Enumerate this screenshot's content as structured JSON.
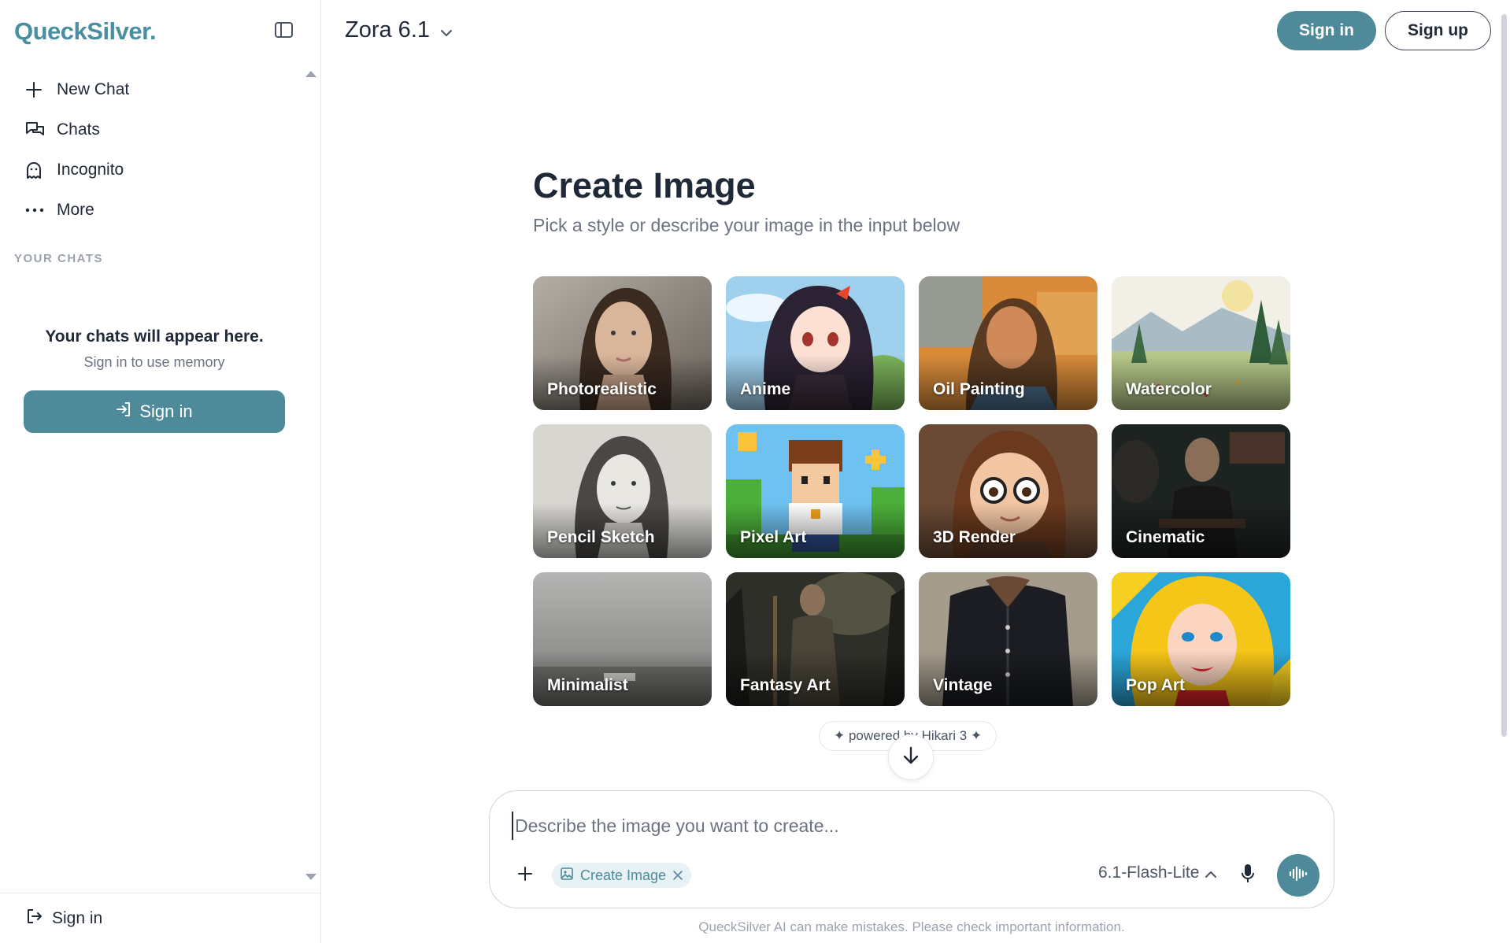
{
  "brand": {
    "name": "QueckSilver."
  },
  "sidebar": {
    "nav": [
      {
        "label": "New Chat",
        "icon": "plus-icon"
      },
      {
        "label": "Chats",
        "icon": "chats-icon"
      },
      {
        "label": "Incognito",
        "icon": "ghost-icon"
      },
      {
        "label": "More",
        "icon": "more-icon"
      }
    ],
    "section_label": "YOUR CHATS",
    "empty_title": "Your chats will appear here.",
    "empty_subtitle": "Sign in to use memory",
    "signin_label": "Sign in",
    "footer_signin_label": "Sign in"
  },
  "header": {
    "model_name": "Zora 6.1",
    "signin_label": "Sign in",
    "signup_label": "Sign up"
  },
  "main": {
    "title": "Create Image",
    "subtitle": "Pick a style or describe your image in the input below",
    "styles": [
      {
        "label": "Photorealistic"
      },
      {
        "label": "Anime"
      },
      {
        "label": "Oil Painting"
      },
      {
        "label": "Watercolor"
      },
      {
        "label": "Pencil Sketch"
      },
      {
        "label": "Pixel Art"
      },
      {
        "label": "3D Render"
      },
      {
        "label": "Cinematic"
      },
      {
        "label": "Minimalist"
      },
      {
        "label": "Fantasy Art"
      },
      {
        "label": "Vintage"
      },
      {
        "label": "Pop Art"
      }
    ],
    "powered_by": "✦ powered by Hikari 3 ✦"
  },
  "composer": {
    "placeholder": "Describe the image you want to create...",
    "mode_chip": "Create Image",
    "model_label": "6.1-Flash-Lite",
    "disclaimer": "QueckSilver AI can make mistakes. Please check important information."
  },
  "colors": {
    "accent": "#4f8a9b",
    "logo": "#4a8ea1"
  }
}
